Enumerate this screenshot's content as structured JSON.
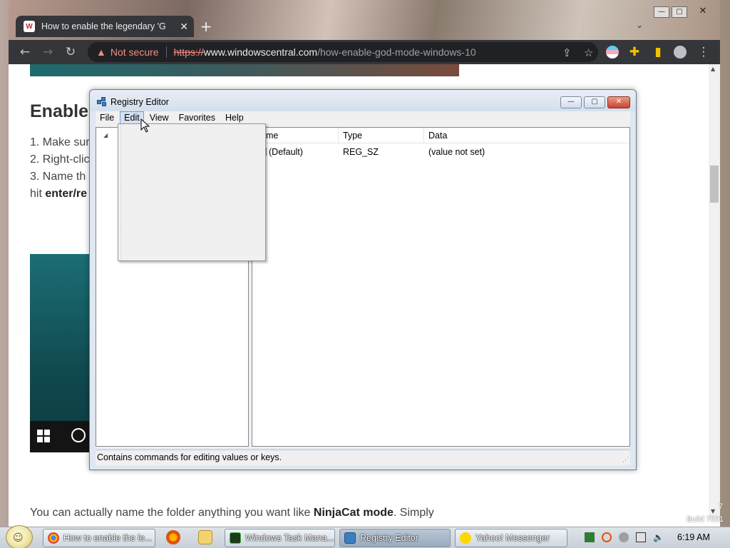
{
  "browser": {
    "tab_title": "How to enable the legendary 'G",
    "tab_favicon": "W",
    "omnibox": {
      "security": "Not secure",
      "protocol": "https://",
      "host": "www.windowscentral.com",
      "path": "/how-enable-god-mode-windows-10"
    },
    "page": {
      "heading": "Enable",
      "steps": [
        "1. Make sur",
        "2. Right-clic",
        "3. Name th"
      ],
      "step_line4_prefix": "hit ",
      "step_line4_bold": "enter/re",
      "footer_text_prefix": "You can actually name the folder anything you want like ",
      "footer_text_bold": "NinjaCat mode",
      "footer_text_suffix": ". Simply"
    }
  },
  "regedit": {
    "title": "Registry Editor",
    "menu": [
      "File",
      "Edit",
      "View",
      "Favorites",
      "Help"
    ],
    "active_menu": "Edit",
    "columns": {
      "name": "Name",
      "type": "Type",
      "data": "Data"
    },
    "column_name_visible": "ame",
    "rows": [
      {
        "name": "(Default)",
        "type": "REG_SZ",
        "data": "(value not set)"
      }
    ],
    "status": "Contains commands for editing values or keys."
  },
  "taskbar": {
    "tasks": [
      {
        "label": "How to enable the le...",
        "icon": "chrome-icon"
      },
      {
        "label": "Windows Task Mana...",
        "icon": "task-manager-icon"
      },
      {
        "label": "Registry Editor",
        "icon": "registry-editor-icon"
      },
      {
        "label": "Yahoo! Messenger",
        "icon": "yahoo-messenger-icon"
      }
    ],
    "clock": "6:19 AM",
    "build": "Build 7001",
    "build_fragment": "7"
  },
  "colors": {
    "chrome_dark": "#35363a",
    "not_secure": "#f28b82",
    "regedit_frame": "#dfe7f1"
  }
}
